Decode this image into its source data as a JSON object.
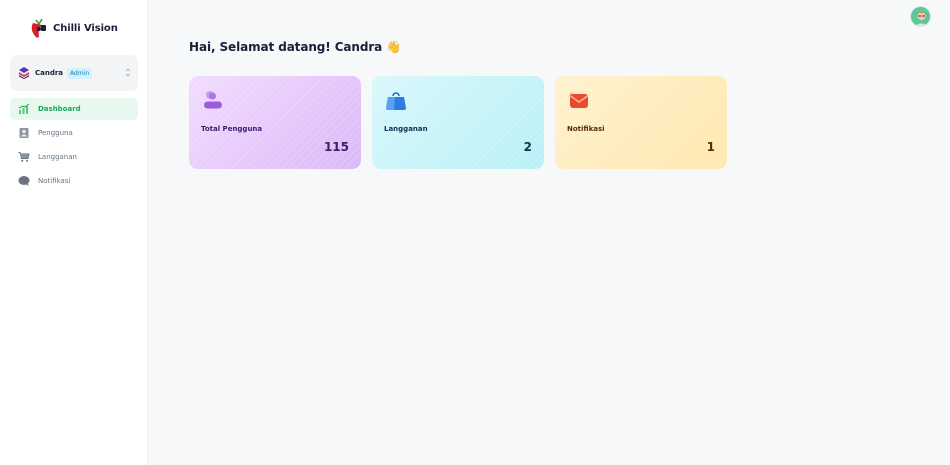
{
  "brand": {
    "name": "Chilli Vision",
    "logo_icon": "chilli-logo-icon"
  },
  "workspace": {
    "name": "Candra",
    "badge": "Admin",
    "icon": "stack-logo-icon"
  },
  "sidebar": {
    "items": [
      {
        "label": "Dashboard",
        "icon": "chart-icon",
        "active": true
      },
      {
        "label": "Pengguna",
        "icon": "user-card-icon",
        "active": false
      },
      {
        "label": "Langganan",
        "icon": "cart-icon",
        "active": false
      },
      {
        "label": "Notifikasi",
        "icon": "chat-bubble-icon",
        "active": false
      }
    ]
  },
  "header": {
    "avatar_icon": "user-avatar-icon"
  },
  "main": {
    "greeting": "Hai, Selamat datang! Candra 👋",
    "cards": [
      {
        "label": "Total Pengguna",
        "value": "115",
        "icon": "users-icon",
        "color": "#b073e8"
      },
      {
        "label": "Langganan",
        "value": "2",
        "icon": "shopping-bag-icon",
        "color": "#2f7be3"
      },
      {
        "label": "Notifikasi",
        "value": "1",
        "icon": "envelope-icon",
        "color": "#e94a2f"
      }
    ]
  },
  "colors": {
    "accent_green": "#1fa65a",
    "sidebar_bg": "#ffffff",
    "page_bg": "#f7f8fa"
  }
}
